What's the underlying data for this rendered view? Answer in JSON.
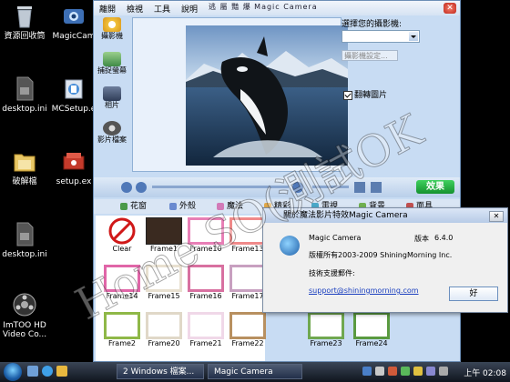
{
  "desktop": {
    "icons": [
      {
        "label": "資源回收筒",
        "icon": "recycle-bin-icon"
      },
      {
        "label": "MagicCam",
        "icon": "magiccamera-icon"
      },
      {
        "label": "desktop.ini",
        "icon": "ini-file-icon"
      },
      {
        "label": "MCSetup.e",
        "icon": "setup-icon"
      },
      {
        "label": "破解檔",
        "icon": "folder-icon"
      },
      {
        "label": "setup.ex",
        "icon": "setup-icon"
      },
      {
        "label": "desktop.ini",
        "icon": "ini-file-icon"
      },
      {
        "label": "ImTOO HD Video Co...",
        "icon": "film-reel-icon"
      }
    ]
  },
  "app": {
    "title": "逃 屬 豔 爆 Magic Camera",
    "menu": [
      "離開",
      "檢視",
      "工具",
      "說明"
    ],
    "sidebar": [
      {
        "label": "攝影機",
        "icon": "camera-icon"
      },
      {
        "label": "捕捉螢幕",
        "icon": "monitor-icon"
      },
      {
        "label": "相片",
        "icon": "photo-icon"
      },
      {
        "label": "影片檔案",
        "icon": "film-icon"
      }
    ],
    "right_panel": {
      "choose_label": "選擇您的攝影機:",
      "camera_value": "",
      "settings_button": "攝影機設定...",
      "flip_checkbox": "翻轉圖片",
      "flip_checked": true
    },
    "effect_button": "效果",
    "tabs": [
      "花窗",
      "外殼",
      "魔法",
      "精彩",
      "電視",
      "背景",
      "面具"
    ],
    "frames": [
      {
        "label": "Clear"
      },
      {
        "label": "Frame1"
      },
      {
        "label": "Frame10"
      },
      {
        "label": "Frame13"
      },
      {
        "label": "Frame14"
      },
      {
        "label": "Frame15"
      },
      {
        "label": "Frame16"
      },
      {
        "label": "Frame17"
      },
      {
        "label": "Frame2"
      },
      {
        "label": "Frame20"
      },
      {
        "label": "Frame21"
      },
      {
        "label": "Frame22"
      },
      {
        "label": "Frame23"
      },
      {
        "label": "Frame24"
      }
    ]
  },
  "about_dialog": {
    "title": "關於魔法影片特效Magic Camera",
    "product": "Magic Camera",
    "version_label": "版本",
    "version": "6.4.0",
    "copyright": "版權所有2003-2009 ShiningMorning Inc.",
    "support_label": "技術支援郵件:",
    "support_email": "support@shiningmorning.com",
    "ok_button": "好"
  },
  "taskbar": {
    "buttons": [
      "2 Windows 檔案...",
      "Magic Camera"
    ],
    "clock": "上午 02:08"
  },
  "watermark": "Home SO(測試OK"
}
